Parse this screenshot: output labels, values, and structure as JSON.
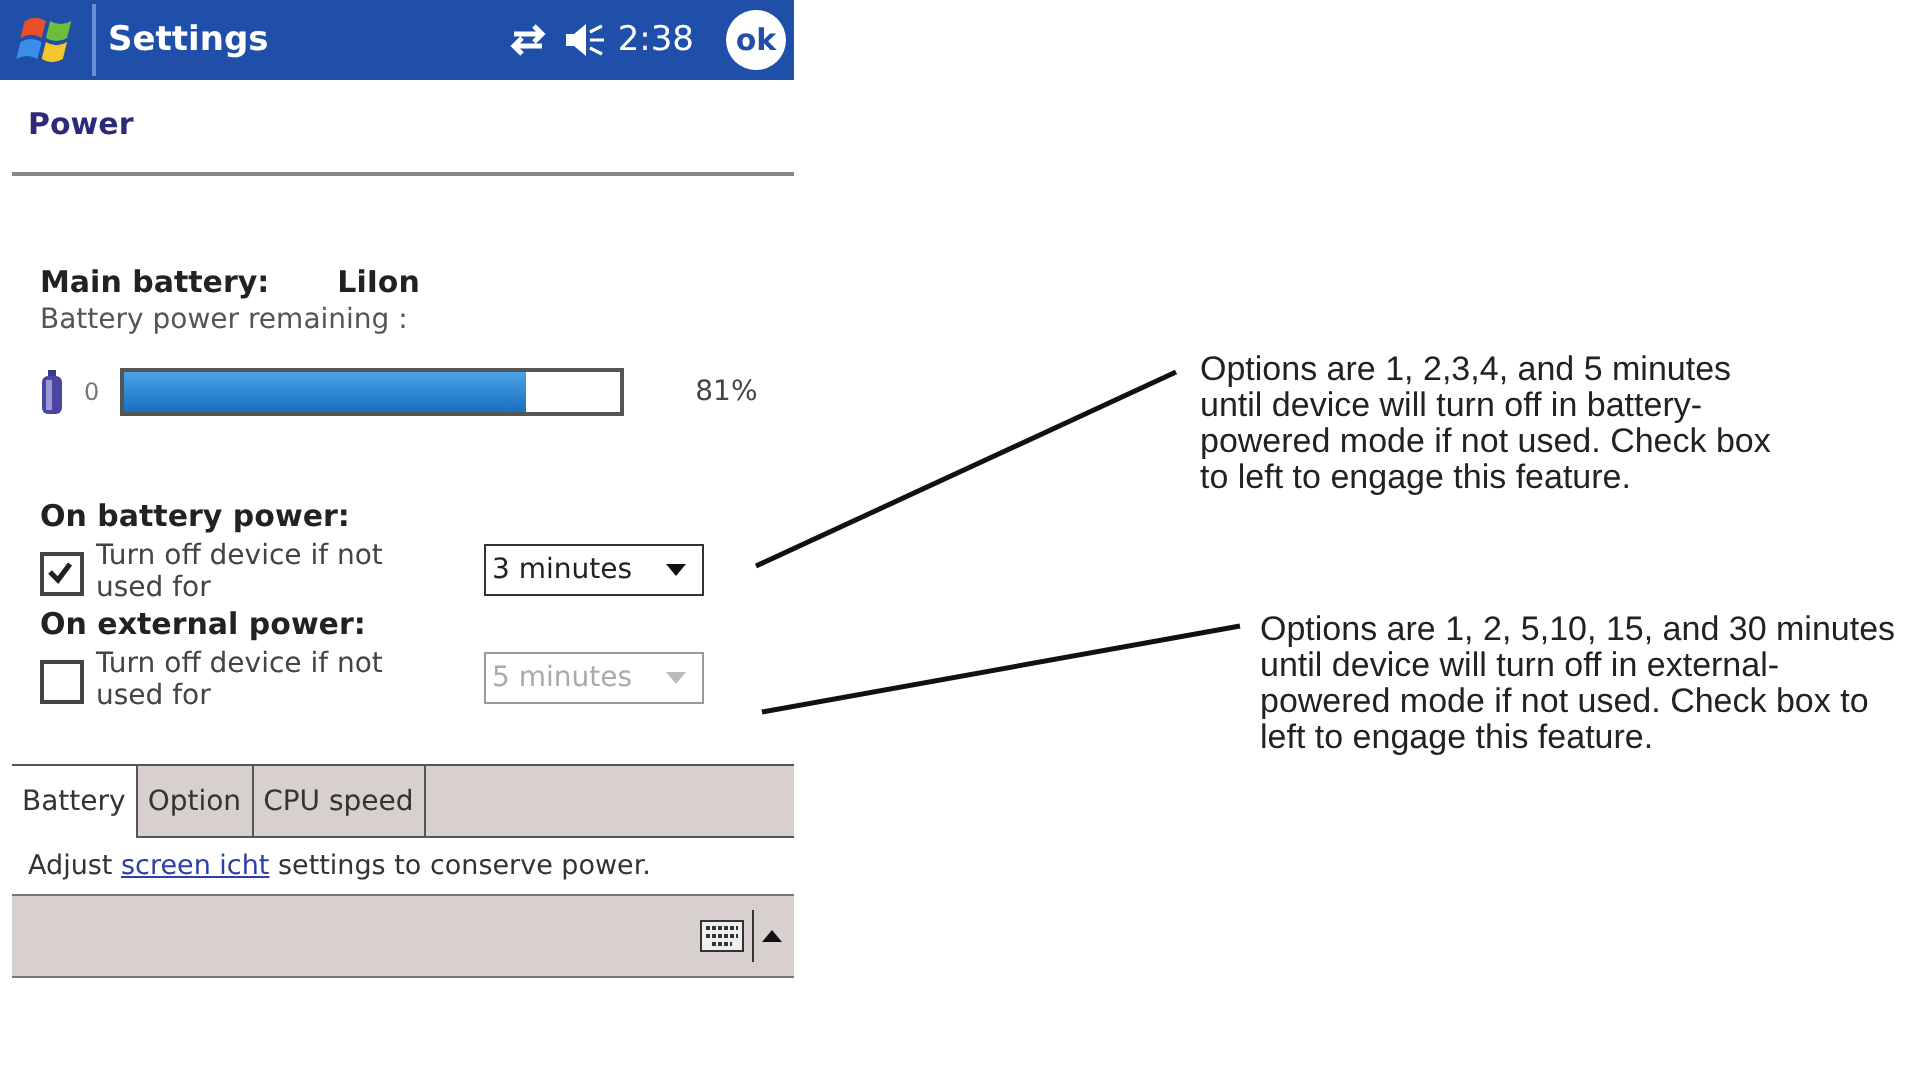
{
  "title_bar": {
    "title": "Settings",
    "time": "2:38",
    "ok_label": "ok"
  },
  "header": {
    "title": "Power"
  },
  "battery": {
    "label": "Main battery:",
    "type": "LiIon",
    "remaining_label": "Battery power remaining :",
    "min_label": "0",
    "level": 0.81,
    "reading": "81%"
  },
  "sections": [
    {
      "heading": "On battery power:",
      "checkbox_label": "Turn off device if not used for",
      "checked": true,
      "dropdown": "3 minutes",
      "disabled": false
    },
    {
      "heading": "On external power:",
      "checkbox_label": "Turn off device if not used for",
      "checked": false,
      "dropdown": "5 minutes",
      "disabled": true
    }
  ],
  "tabs": [
    {
      "label": "Battery",
      "selected": true
    },
    {
      "label": "Option",
      "selected": false
    },
    {
      "label": "CPU speed",
      "selected": false
    }
  ],
  "hint": {
    "before": "Adjust ",
    "link": "screen icht",
    "after": " settings to conserve power."
  },
  "callouts": [
    "Options are 1, 2,3,4, and 5 minutes until device will turn off in battery-powered mode if not used. Check box to left to engage this feature.",
    "Options are 1, 2, 5,10, 15, and 30 minutes until device will turn off in external-powered mode if not used. Check box to left to engage this feature."
  ]
}
